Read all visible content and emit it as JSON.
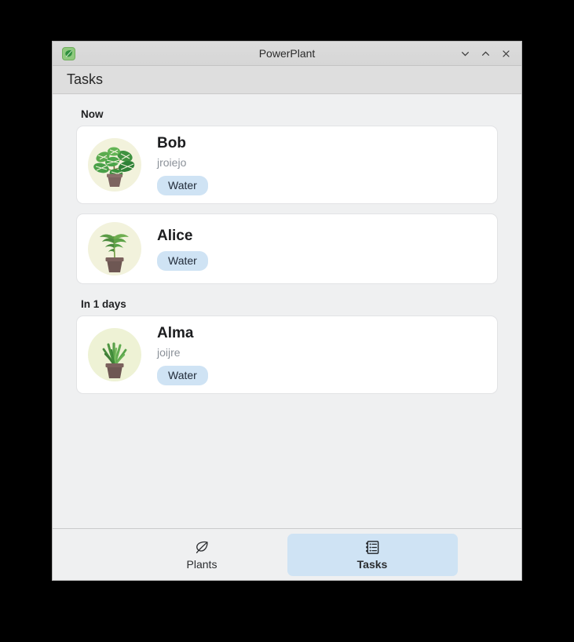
{
  "window": {
    "title": "PowerPlant",
    "app_icon": "leaf-icon",
    "controls": {
      "minimize": "chevron-down-icon",
      "maximize": "chevron-up-icon",
      "close": "close-icon"
    }
  },
  "header": {
    "title": "Tasks"
  },
  "groups": [
    {
      "label": "Now",
      "cards": [
        {
          "name": "Bob",
          "subtitle": "jroiejo",
          "badge": "Water",
          "plant": "monstera-plant-icon"
        },
        {
          "name": "Alice",
          "subtitle": "",
          "badge": "Water",
          "plant": "palm-sapling-icon"
        }
      ]
    },
    {
      "label": "In 1 days",
      "cards": [
        {
          "name": "Alma",
          "subtitle": "joijre",
          "badge": "Water",
          "plant": "aloe-plant-icon"
        }
      ]
    }
  ],
  "bottom_nav": {
    "items": [
      {
        "label": "Plants",
        "icon": "leaf-outline-icon",
        "selected": false
      },
      {
        "label": "Tasks",
        "icon": "task-list-icon",
        "selected": true
      }
    ]
  },
  "colors": {
    "accent_badge": "#cfe3f4",
    "window_bg": "#eff0f1",
    "card_bg": "#ffffff",
    "titlebar_bg": "#dcdcdc",
    "headerbar_bg": "#dedede",
    "subtitle_text": "#8b9199"
  }
}
